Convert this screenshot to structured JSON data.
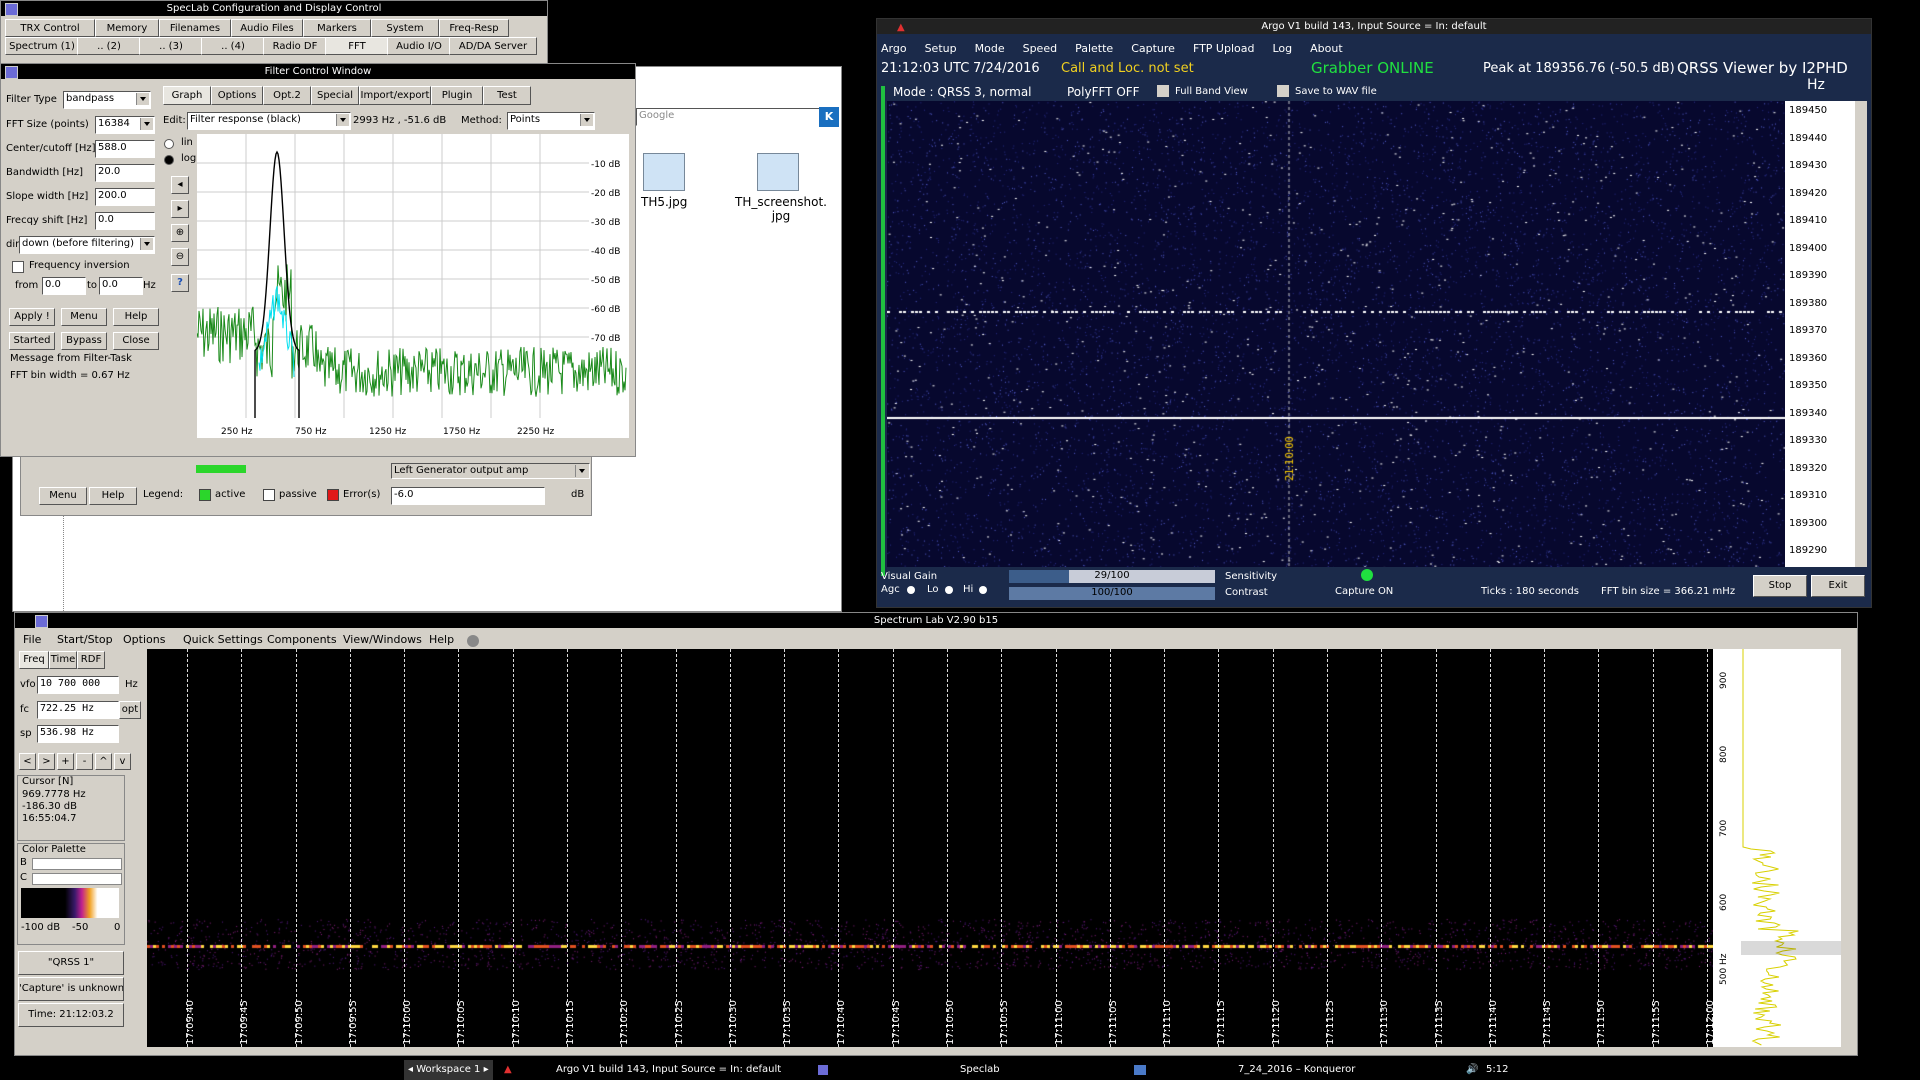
{
  "speclab_config": {
    "title": "SpecLab   Configuration and Display Control",
    "tabs_row1": [
      "TRX Control",
      "Memory",
      "Filenames",
      "Audio Files",
      "Markers",
      "System",
      "Freq-Resp"
    ],
    "tabs_row2": [
      "Spectrum (1)",
      ".. (2)",
      ".. (3)",
      ".. (4)",
      "Radio DF",
      "FFT",
      "Audio I/O",
      "AD/DA Server"
    ]
  },
  "filter_window": {
    "title": "Filter Control Window",
    "filter_type_label": "Filter Type",
    "filter_type_value": "bandpass",
    "fft_size_label": "FFT Size (points)",
    "fft_size_value": "16384",
    "center_label": "Center/cutoff [Hz]",
    "center_value": "588.0",
    "bandwidth_label": "Bandwidth [Hz]",
    "bandwidth_value": "20.0",
    "slope_label": "Slope width [Hz]",
    "slope_value": "200.0",
    "shift_label": "Frecqy shift [Hz]",
    "shift_value": "0.0",
    "dir_label": "dir",
    "dir_value": "down (before filtering)",
    "freq_inversion_label": "Frequency inversion",
    "from_label": "from",
    "from_value": "0.0",
    "to_label": "to",
    "to_value": "0.0",
    "hz_label": "Hz",
    "apply_label": "Apply !",
    "menu_label": "Menu",
    "help_label": "Help",
    "started_label": "Started",
    "bypass_label": "Bypass",
    "close_label": "Close",
    "message_label": "Message from Filter-Task",
    "bin_width": "FFT bin width = 0.67 Hz",
    "tabs": [
      "Graph",
      "Options",
      "Opt.2",
      "Special",
      "Import/export",
      "Plugin",
      "Test"
    ],
    "edit_label": "Edit:",
    "edit_value": "Filter response (black)",
    "readout": "2993  Hz , -51.6 dB",
    "method_label": "Method:",
    "method_value": "Points",
    "lin_label": "lin",
    "log_label": "log",
    "db_labels": [
      "-10 dB",
      "-20 dB",
      "-30 dB",
      "-40 dB",
      "-50 dB",
      "-60 dB",
      "-70 dB"
    ],
    "x_labels": [
      "250 Hz",
      "750 Hz",
      "1250 Hz",
      "1750 Hz",
      "2250 Hz"
    ]
  },
  "generator_panel": {
    "dropdown_value": "Left Generator output amp",
    "menu_label": "Menu",
    "help_label": "Help",
    "legend_label": "Legend:",
    "active_label": "active",
    "passive_label": "passive",
    "error_label": "Error(s)",
    "value": "-6.0",
    "unit": "dB"
  },
  "konqueror": {
    "search_placeholder": "Google",
    "files": [
      "TH5.jpg",
      "TH_screenshot.\njpg"
    ]
  },
  "argo": {
    "title": "Argo V1 build 143, Input Source = In: default",
    "menu": [
      "Argo",
      "Setup",
      "Mode",
      "Speed",
      "Palette",
      "Capture",
      "FTP Upload",
      "Log",
      "About"
    ],
    "time": "21:12:03 UTC",
    "date": "7/24/2016",
    "call_status": "Call and Loc. not set",
    "grabber": "Grabber ONLINE",
    "peak": "Peak at  189356.76 (-50.5 dB)",
    "viewer": "QRSS Viewer by I2PHD",
    "hz": "Hz",
    "mode": "Mode : QRSS 3, normal",
    "polyfft": "PolyFFT OFF",
    "full_band": "Full Band View",
    "save_wav": "Save to WAV file",
    "freq_labels": [
      "189450",
      "189440",
      "189430",
      "189420",
      "189410",
      "189400",
      "189390",
      "189380",
      "189370",
      "189360",
      "189350",
      "189340",
      "189330",
      "189320",
      "189310",
      "189300",
      "189290"
    ],
    "time_marker": "21:10:00",
    "visual_gain": "Visual Gain",
    "agc": "Agc",
    "lo": "Lo",
    "hi": "Hi",
    "sensitivity_value": "29/100",
    "sensitivity_fill": 0.29,
    "contrast_value": "100/100",
    "contrast_fill": 1.0,
    "sensitivity_label": "Sensitivity",
    "contrast_label": "Contrast",
    "capture": "Capture ON",
    "ticks": "Ticks   : 180 seconds",
    "fft_bin": "FFT bin size = 366.21 mHz",
    "stop": "Stop",
    "exit": "Exit"
  },
  "spectrum_lab": {
    "title": "Spectrum Lab V2.90 b15",
    "menu": [
      "File",
      "Start/Stop",
      "Options",
      "Quick Settings",
      "Components",
      "View/Windows",
      "Help"
    ],
    "tabs": [
      "Freq",
      "Time",
      "RDF"
    ],
    "vfo_label": "vfo",
    "vfo_value": "10 700 000",
    "vfo_unit": "Hz",
    "fc_label": "fc",
    "fc_value": "722.25 Hz",
    "opt_label": "opt",
    "sp_label": "sp",
    "sp_value": "536.98 Hz",
    "nav_buttons": [
      "<",
      ">",
      "+",
      "-",
      "^",
      "v"
    ],
    "cursor_title": "Cursor [N]",
    "cursor_freq": "969.7778 Hz",
    "cursor_db": "-186.30 dB",
    "cursor_time": "16:55:04.7",
    "palette_title": "Color Palette",
    "b_label": "B",
    "c_label": "C",
    "scale": [
      "-100 dB",
      "-50",
      "0"
    ],
    "qrss_button": "\"QRSS 1\"",
    "capture_status": "'Capture' is unknown",
    "time_display": "Time:  21:12:03.2",
    "time_labels": [
      "17:09:40",
      "17:09:45",
      "17:09:50",
      "17:09:55",
      "17:10:00",
      "17:10:05",
      "17:10:10",
      "17:10:15",
      "17:10:20",
      "17:10:25",
      "17:10:30",
      "17:10:35",
      "17:10:40",
      "17:10:45",
      "17:10:50",
      "17:10:55",
      "17:11:00",
      "17:11:05",
      "17:11:10",
      "17:11:15",
      "17:11:20",
      "17:11:25",
      "17:11:30",
      "17:11:35",
      "17:11:40",
      "17:11:45",
      "17:11:50",
      "17:11:55",
      "17:12:00"
    ],
    "freq_scale": [
      "900",
      "800",
      "700",
      "600",
      "500 Hz"
    ]
  },
  "taskbar": {
    "workspace": "◂ Workspace 1 ▸",
    "argo_task": "Argo V1 build 143, Input Source = In: default",
    "speclab_task": "Speclab",
    "konq_task": "7_24_2016 – Konqueror",
    "clock": "5:12"
  }
}
